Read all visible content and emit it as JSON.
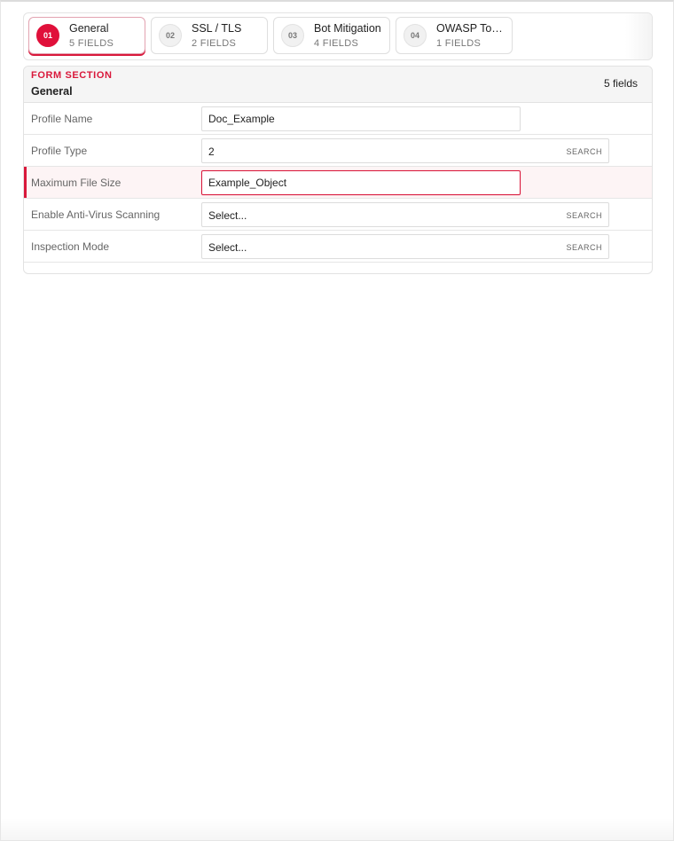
{
  "tabs": [
    {
      "num": "01",
      "title": "General",
      "sub": "5 FIELDS",
      "active": true
    },
    {
      "num": "02",
      "title": "SSL / TLS",
      "sub": "2 FIELDS",
      "active": false
    },
    {
      "num": "03",
      "title": "Bot Mitigation",
      "sub": "4 FIELDS",
      "active": false
    },
    {
      "num": "04",
      "title": "OWASP To…",
      "sub": "1 FIELDS",
      "active": false
    }
  ],
  "section": {
    "kicker": "FORM SECTION",
    "title": "General",
    "count": "5 fields"
  },
  "fields": {
    "profile_name": {
      "label": "Profile Name",
      "value": "Doc_Example"
    },
    "profile_type": {
      "label": "Profile Type",
      "value": "2",
      "action": "SEARCH"
    },
    "max_file_size": {
      "label": "Maximum File Size",
      "value": "Example_Object"
    },
    "antivirus": {
      "label": "Enable Anti-Virus Scanning",
      "value": "Select...",
      "action": "SEARCH"
    },
    "inspection_mode": {
      "label": "Inspection Mode",
      "value": "Select...",
      "action": "SEARCH"
    }
  },
  "colors": {
    "accent": "#d9183b",
    "active_badge": "#e0103a"
  }
}
